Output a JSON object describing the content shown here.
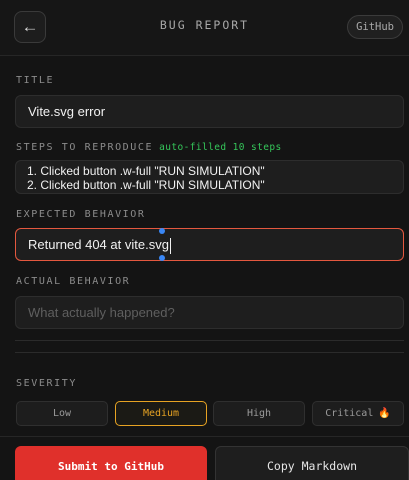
{
  "header": {
    "back_icon": "←",
    "title": "BUG REPORT",
    "github_label": "GitHub"
  },
  "form": {
    "title_label": "TITLE",
    "title_value": "Vite.svg error",
    "steps_label": "STEPS TO REPRODUCE",
    "steps_hint": "auto-filled 10 steps",
    "steps_lines": [
      "1. Clicked button .w-full \"RUN SIMULATION\"",
      "2. Clicked button .w-full \"RUN SIMULATION\""
    ],
    "expected_label": "EXPECTED BEHAVIOR",
    "expected_value": "Returned 404 at vite.svg",
    "actual_label": "ACTUAL BEHAVIOR",
    "actual_placeholder": "What actually happened?"
  },
  "severity": {
    "label": "SEVERITY",
    "options": [
      "Low",
      "Medium",
      "High",
      "Critical"
    ],
    "selected": "Medium",
    "critical_icon": "🔥"
  },
  "actions": {
    "submit_label": "Submit to GitHub",
    "copy_label": "Copy Markdown"
  },
  "colors": {
    "accent_red": "#e0302b",
    "selected_amber": "#e7a323",
    "hint_green": "#35c65a",
    "focus_border": "#e4583f"
  }
}
